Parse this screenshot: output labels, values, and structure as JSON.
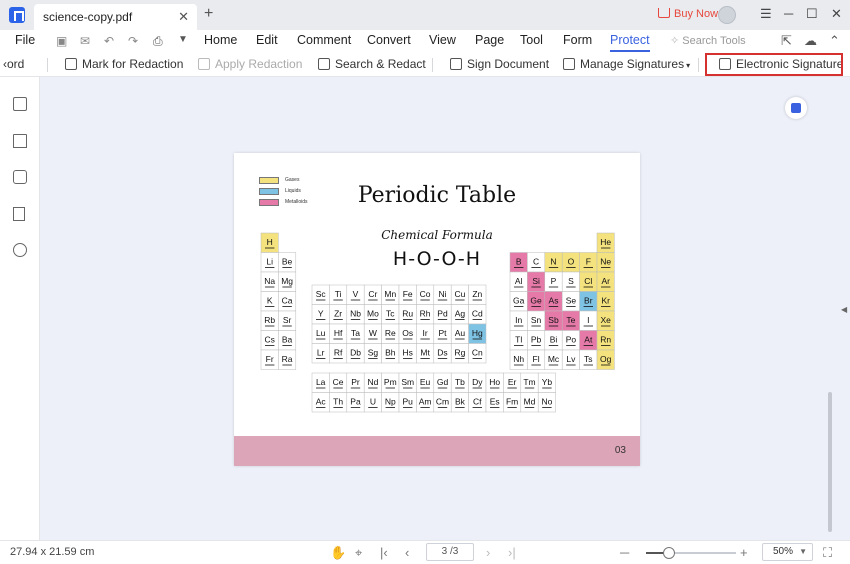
{
  "titlebar": {
    "tab_title": "science-copy.pdf",
    "close_glyph": "✕",
    "new_tab_glyph": "+",
    "buy_now": "Buy Now",
    "minimize_glyph": "─",
    "maximize_glyph": "☐",
    "close_window_glyph": "✕"
  },
  "menubar": {
    "file": "File",
    "items": [
      "Home",
      "Edit",
      "Comment",
      "Convert",
      "View",
      "Page",
      "Tool",
      "Form",
      "Protect"
    ],
    "active": "Protect",
    "search_placeholder": "Search Tools"
  },
  "ribbon": {
    "back_label": "‹ord",
    "items": [
      {
        "label": "Mark for Redaction",
        "enabled": true,
        "icon": "mark-redaction-icon"
      },
      {
        "label": "Apply Redaction",
        "enabled": false,
        "icon": "apply-redaction-icon"
      },
      {
        "label": "Search & Redact",
        "enabled": true,
        "icon": "search-redact-icon"
      },
      {
        "label": "Sign Document",
        "enabled": true,
        "icon": "sign-document-icon"
      },
      {
        "label": "Manage Signatures",
        "enabled": true,
        "icon": "manage-signatures-icon"
      },
      {
        "label": "Electronic Signature",
        "enabled": true,
        "icon": "electronic-signature-icon"
      }
    ],
    "highlight_color": "#d63131"
  },
  "document": {
    "title": "Periodic Table",
    "subtitle": "Chemical Formula",
    "formula": "H-O-O-H",
    "page_label": "03",
    "legend": [
      {
        "label": "Gases",
        "color": "#f3e27d"
      },
      {
        "label": "Liquids",
        "color": "#7fc3e4"
      },
      {
        "label": "Metalloids",
        "color": "#e57aa8"
      }
    ],
    "elements_left": [
      [
        "H",
        ""
      ],
      [
        "Li",
        "Be"
      ],
      [
        "Na",
        "Mg"
      ],
      [
        "K",
        "Ca"
      ],
      [
        "Rb",
        "Sr"
      ],
      [
        "Cs",
        "Ba"
      ],
      [
        "Fr",
        "Ra"
      ]
    ],
    "elements_transition": [
      [
        "Sc",
        "Ti",
        "V",
        "Cr",
        "Mn",
        "Fe",
        "Co",
        "Ni",
        "Cu",
        "Zn"
      ],
      [
        "Y",
        "Zr",
        "Nb",
        "Mo",
        "Tc",
        "Ru",
        "Rh",
        "Pd",
        "Ag",
        "Cd"
      ],
      [
        "Lu",
        "Hf",
        "Ta",
        "W",
        "Re",
        "Os",
        "Ir",
        "Pt",
        "Au",
        "Hg"
      ],
      [
        "Lr",
        "Rf",
        "Db",
        "Sg",
        "Bh",
        "Hs",
        "Mt",
        "Ds",
        "Rg",
        "Cn"
      ]
    ],
    "elements_right": [
      [
        "",
        "",
        "",
        "",
        "",
        "He"
      ],
      [
        "B",
        "C",
        "N",
        "O",
        "F",
        "Ne"
      ],
      [
        "Al",
        "Si",
        "P",
        "S",
        "Cl",
        "Ar"
      ],
      [
        "Ga",
        "Ge",
        "As",
        "Se",
        "Br",
        "Kr"
      ],
      [
        "In",
        "Sn",
        "Sb",
        "Te",
        "I",
        "Xe"
      ],
      [
        "Tl",
        "Pb",
        "Bi",
        "Po",
        "At",
        "Rn"
      ],
      [
        "Nh",
        "Fl",
        "Mc",
        "Lv",
        "Ts",
        "Og"
      ]
    ],
    "elements_f_block": [
      [
        "La",
        "Ce",
        "Pr",
        "Nd",
        "Pm",
        "Sm",
        "Eu",
        "Gd",
        "Tb",
        "Dy",
        "Ho",
        "Er",
        "Tm",
        "Yb"
      ],
      [
        "Ac",
        "Th",
        "Pa",
        "U",
        "Np",
        "Pu",
        "Am",
        "Cm",
        "Bk",
        "Cf",
        "Es",
        "Fm",
        "Md",
        "No"
      ]
    ],
    "gases": [
      "H",
      "He",
      "N",
      "O",
      "F",
      "Cl",
      "Ne",
      "Ar",
      "Kr",
      "Xe",
      "Rn",
      "Og"
    ],
    "liquids": [
      "Hg",
      "Br"
    ],
    "metalloids": [
      "B",
      "Si",
      "Ge",
      "As",
      "Sb",
      "Te",
      "At"
    ]
  },
  "statusbar": {
    "dimensions": "27.94 x 21.59 cm",
    "page_input": "3 /3",
    "zoom": "50%",
    "zoom_level_fraction": 0.25
  }
}
